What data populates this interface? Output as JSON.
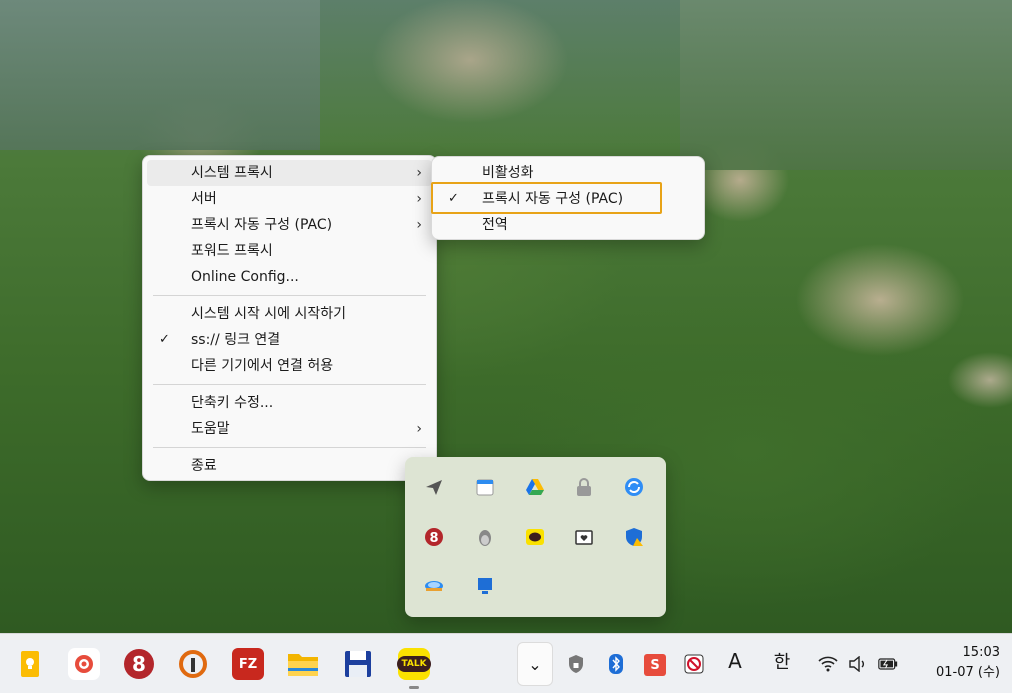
{
  "main_menu": {
    "items": [
      {
        "label": "시스템 프록시",
        "arrow": "›",
        "check": ""
      },
      {
        "label": "서버",
        "arrow": "›",
        "check": ""
      },
      {
        "label": "프록시 자동 구성 (PAC)",
        "arrow": "›",
        "check": ""
      },
      {
        "label": "포워드 프록시",
        "arrow": "",
        "check": ""
      },
      {
        "label": "Online Config...",
        "arrow": "",
        "check": ""
      },
      {
        "label": "시스템 시작 시에 시작하기",
        "arrow": "",
        "check": ""
      },
      {
        "label": "ss:// 링크 연결",
        "arrow": "",
        "check": "✓"
      },
      {
        "label": "다른 기기에서 연결 허용",
        "arrow": "",
        "check": ""
      },
      {
        "label": "단축키 수정...",
        "arrow": "",
        "check": ""
      },
      {
        "label": "도움말",
        "arrow": "›",
        "check": ""
      },
      {
        "label": "종료",
        "arrow": "",
        "check": ""
      }
    ]
  },
  "sub_menu": {
    "items": [
      {
        "label": "비활성화",
        "check": ""
      },
      {
        "label": "프록시 자동 구성 (PAC)",
        "check": "✓"
      },
      {
        "label": "전역",
        "check": ""
      }
    ]
  },
  "tray_flyout": {
    "icons": [
      "paper-plane-icon",
      "calendar-icon",
      "google-drive-icon",
      "lock-icon",
      "sync-icon",
      "app-8-icon",
      "tux-icon",
      "kakaotalk-icon",
      "folder-heart-icon",
      "shield-warning-icon",
      "network-drive-icon",
      "monitor-icon"
    ]
  },
  "taskbar": {
    "apps": [
      "keep-icon",
      "snail-icon",
      "app-8-icon",
      "wireguard-icon",
      "filezilla-icon",
      "file-explorer-icon",
      "save-icon",
      "kakaotalk-icon"
    ],
    "filezilla_text": "FZ",
    "kakaotalk_text": "TALK",
    "chevron": "⌄",
    "ime_mode": "A",
    "ime_lang": "한",
    "time": "15:03",
    "date": "01-07 (수)"
  },
  "colors": {
    "highlight_border": "#e8a317",
    "menu_bg": "#f9f9f9",
    "taskbar_bg": "#eef0f3"
  }
}
